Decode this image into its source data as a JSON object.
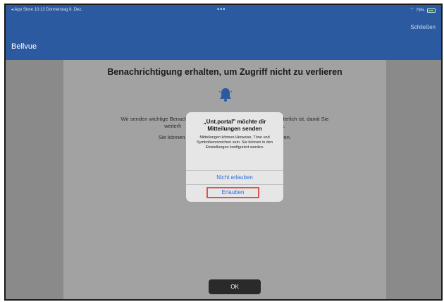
{
  "status_bar": {
    "left": "◂ App Store  10:13  Donnerstag 8. Dez.",
    "center": "•••",
    "battery": "79%"
  },
  "header": {
    "close_label": "Schließen",
    "app_title": "Bellvue"
  },
  "main": {
    "headline": "Benachrichtigung erhalten, um Zugriff nicht zu verlieren",
    "body_line1": "Wir senden wichtige Benachric‌                                          Aktion erforderlich ist, damit Sie",
    "body_line2": "weiterh                                                          können.",
    "body_line3": "Sie können di                                                deaktivieren.",
    "ok_label": "OK"
  },
  "dialog": {
    "title": "„Unt.portal\" möchte dir Mitteilungen senden",
    "message": "Mitteilungen können Hinweise, Töne und Symbolkennzeichen sein. Sie können in den Einstellungen konfiguriert werden.",
    "deny_label": "Nicht erlauben",
    "allow_label": "Erlauben"
  },
  "colors": {
    "header": "#2c5aa0",
    "accent": "#2f6fe0",
    "highlight": "#d9534f"
  }
}
